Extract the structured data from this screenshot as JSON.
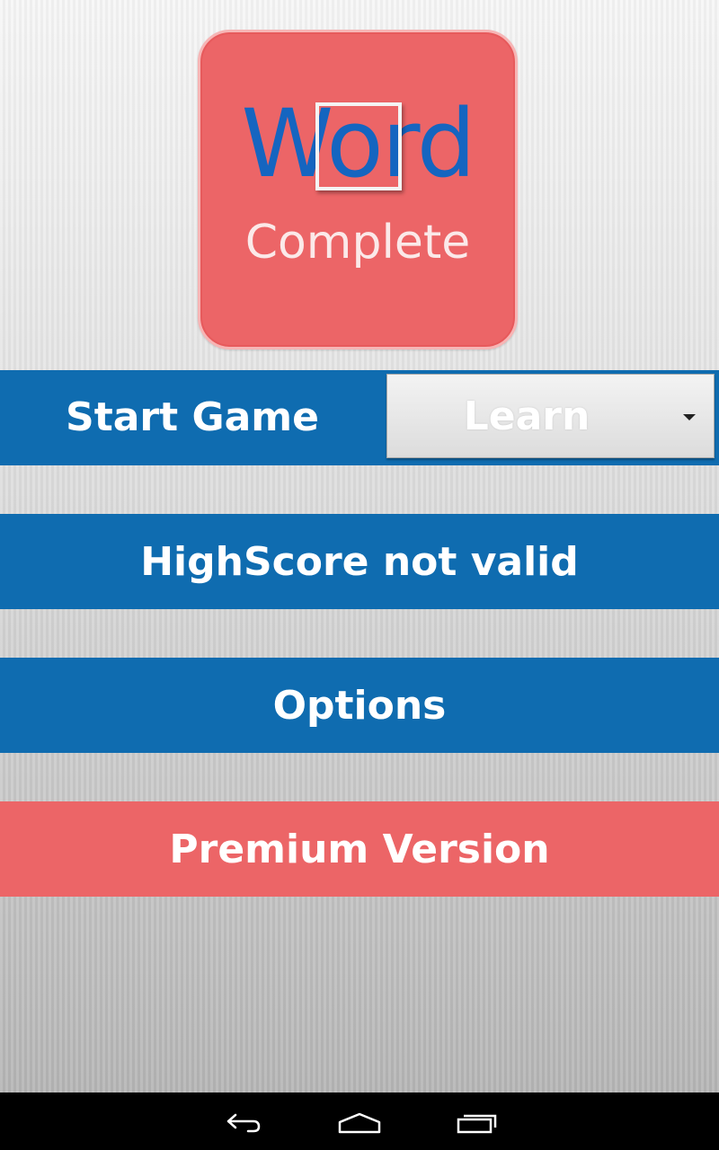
{
  "logo": {
    "word": "Word",
    "subtitle": "Complete"
  },
  "menu": {
    "start_label": "Start Game",
    "mode_selected": "Learn",
    "highscore_label": "HighScore not valid",
    "options_label": "Options",
    "premium_label": "Premium Version"
  },
  "colors": {
    "primary_blue": "#0f6cb0",
    "accent_red": "#ec6567",
    "logo_text_blue": "#1565c0"
  },
  "navbar": {
    "back_icon": "back-icon",
    "home_icon": "home-icon",
    "recent_icon": "recent-apps-icon"
  }
}
